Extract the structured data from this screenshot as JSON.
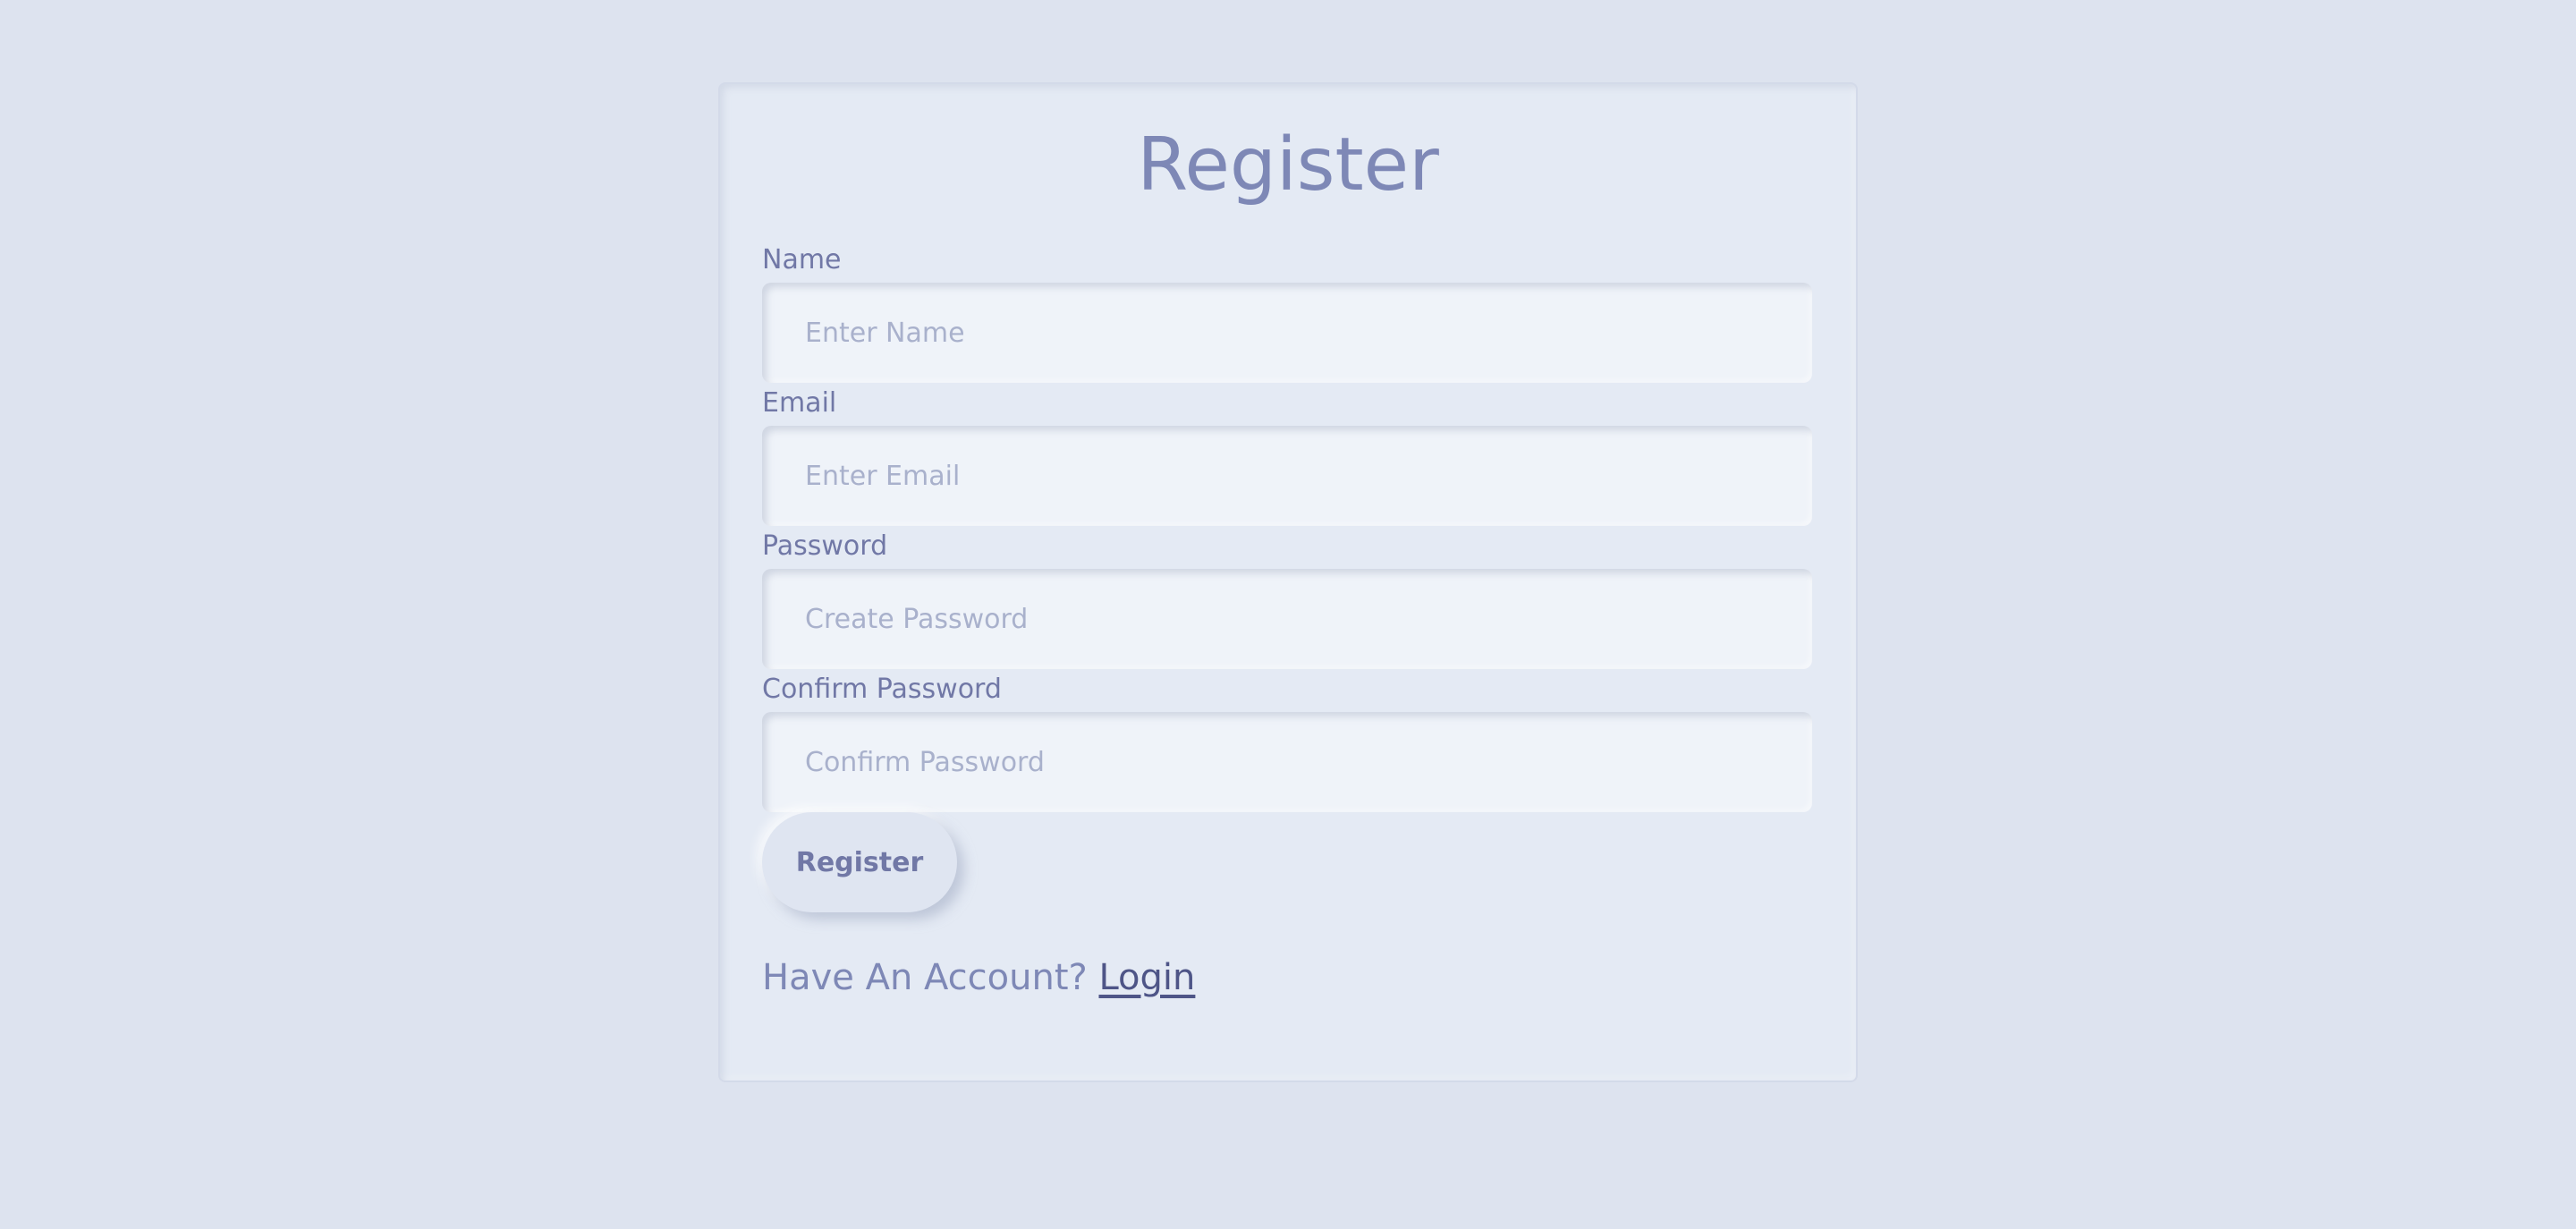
{
  "form": {
    "title": "Register",
    "fields": [
      {
        "label": "Name",
        "placeholder": "Enter Name",
        "value": ""
      },
      {
        "label": "Email",
        "placeholder": "Enter Email",
        "value": ""
      },
      {
        "label": "Password",
        "placeholder": "Create Password",
        "value": ""
      },
      {
        "label": "Confirm Password",
        "placeholder": "Confirm Password",
        "value": ""
      }
    ],
    "submit_label": "Register",
    "footer_text": "Have An Account?",
    "login_link": "Login"
  },
  "colors": {
    "background": "#dde3ef",
    "card": "#e4eaf4",
    "input": "#eff3f9",
    "text": "#7178a6",
    "title": "#7e88b6",
    "link": "#4e5587",
    "placeholder": "#a9b1cc"
  }
}
